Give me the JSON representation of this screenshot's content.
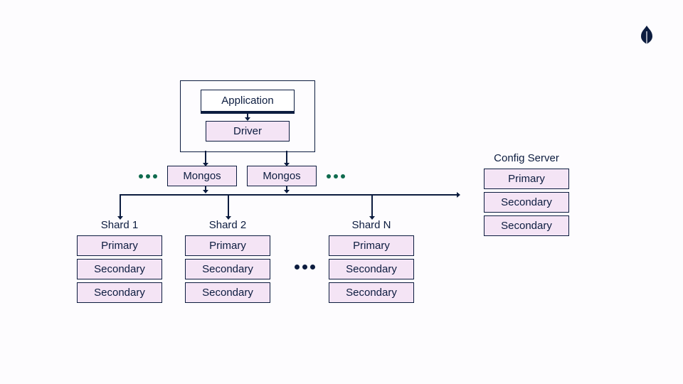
{
  "logo": {
    "name": "mongodb-leaf-icon"
  },
  "app": {
    "application_label": "Application",
    "driver_label": "Driver"
  },
  "mongos": {
    "label_left": "Mongos",
    "label_right": "Mongos"
  },
  "config": {
    "title": "Config Server",
    "primary": "Primary",
    "secondary1": "Secondary",
    "secondary2": "Secondary"
  },
  "shards": [
    {
      "title": "Shard 1",
      "primary": "Primary",
      "secondary1": "Secondary",
      "secondary2": "Secondary"
    },
    {
      "title": "Shard 2",
      "primary": "Primary",
      "secondary1": "Secondary",
      "secondary2": "Secondary"
    },
    {
      "title": "Shard N",
      "primary": "Primary",
      "secondary1": "Secondary",
      "secondary2": "Secondary"
    }
  ]
}
